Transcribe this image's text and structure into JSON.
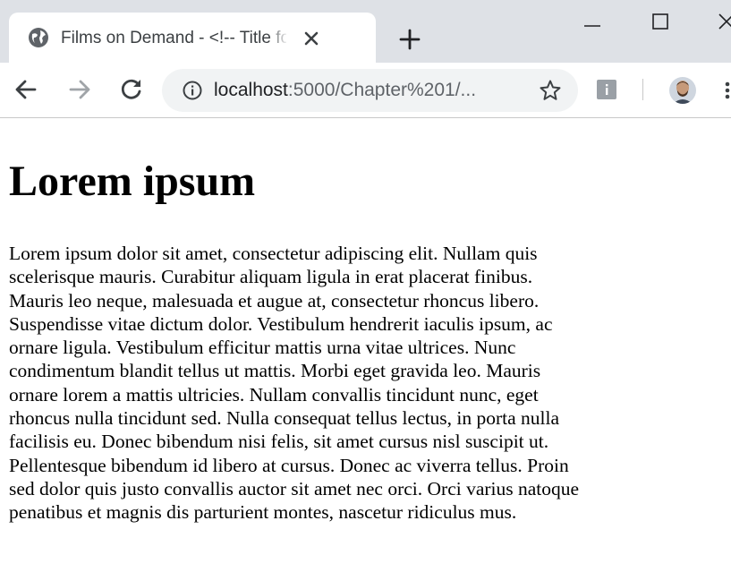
{
  "browser": {
    "tab": {
      "title": "Films on Demand - <!-- Title for page -->",
      "favicon": "globe-icon",
      "close_icon": "close-icon"
    },
    "new_tab_icon": "plus-icon",
    "window_controls": [
      "minimize-icon",
      "maximize-icon",
      "close-icon"
    ],
    "toolbar": {
      "back_icon": "arrow-left-icon",
      "forward_icon": "arrow-right-icon",
      "reload_icon": "reload-icon",
      "address": {
        "info_icon": "info-icon",
        "host": "localhost",
        "rest": ":5000/Chapter%201/...",
        "bookmark_icon": "star-icon"
      },
      "extension_icon": "extension-icon",
      "avatar_icon": "avatar-icon",
      "menu_icon": "kebab-menu-icon"
    }
  },
  "page": {
    "heading": "Lorem ipsum",
    "paragraph_lines": [
      "Lorem ipsum dolor sit amet, consectetur adipiscing elit. Nullam quis",
      "scelerisque mauris. Curabitur aliquam ligula in erat placerat finibus.",
      "Mauris leo neque, malesuada et augue at, consectetur rhoncus libero.",
      "Suspendisse vitae dictum dolor. Vestibulum hendrerit iaculis ipsum, ac",
      "ornare ligula. Vestibulum efficitur mattis urna vitae ultrices. Nunc",
      "condimentum blandit tellus ut mattis. Morbi eget gravida leo. Mauris",
      "ornare lorem a mattis ultricies. Nullam convallis tincidunt nunc, eget",
      "rhoncus nulla tincidunt sed. Nulla consequat tellus lectus, in porta nulla",
      "facilisis eu. Donec bibendum nisi felis, sit amet cursus nisl suscipit ut.",
      "Pellentesque bibendum id libero at cursus. Donec ac viverra tellus. Proin",
      "sed dolor quis justo convallis auctor sit amet nec orci. Orci varius natoque",
      "penatibus et magnis dis parturient montes, nascetur ridiculus mus."
    ]
  },
  "colors": {
    "tabstrip": "#dee1e6",
    "omnibox": "#f1f3f4",
    "icon": "#5f6368",
    "text": "#000000"
  }
}
